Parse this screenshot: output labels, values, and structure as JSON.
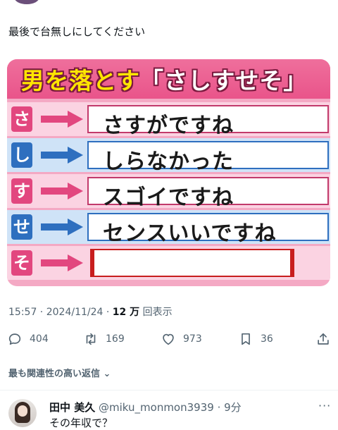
{
  "post": {
    "text": "最後で台無しにしてください"
  },
  "image": {
    "title_prefix": "男を落とす",
    "title_quoted": "「さしすせそ」",
    "rows": [
      {
        "kana": "さ",
        "answer": "さすがですね",
        "tile_color": "#e2477f",
        "row_color": "#fbd3e2",
        "arrow_color": "#e2477f",
        "box_color": "#c23a6b"
      },
      {
        "kana": "し",
        "answer": "しらなかった",
        "tile_color": "#2e6fbf",
        "row_color": "#cfe3f7",
        "arrow_color": "#2e6fbf",
        "box_color": "#2e6fbf"
      },
      {
        "kana": "す",
        "answer": "スゴイですね",
        "tile_color": "#e2477f",
        "row_color": "#fbd3e2",
        "arrow_color": "#e2477f",
        "box_color": "#c23a6b"
      },
      {
        "kana": "せ",
        "answer": "センスいいですね",
        "tile_color": "#2e6fbf",
        "row_color": "#cfe3f7",
        "arrow_color": "#2e6fbf",
        "box_color": "#2e6fbf"
      },
      {
        "kana": "そ",
        "answer": "",
        "tile_color": "#e2477f",
        "row_color": "#fbd3e2",
        "arrow_color": "#e2477f",
        "box_color": "#c81e1e"
      }
    ]
  },
  "meta": {
    "time": "15:57",
    "date": "2024/11/24",
    "views_count": "12 万",
    "views_label": "回表示"
  },
  "actions": {
    "replies": "404",
    "reposts": "169",
    "likes": "973",
    "bookmarks": "36"
  },
  "related_label": "最も関連性の高い返信",
  "reply": {
    "name": "田中 美久",
    "handle": "@miku_monmon3939",
    "time": "9分",
    "text": "その年収で？"
  },
  "colors": {
    "banner": "#e9548a",
    "title_yellow": "#ffe600",
    "muted": "#536471"
  }
}
